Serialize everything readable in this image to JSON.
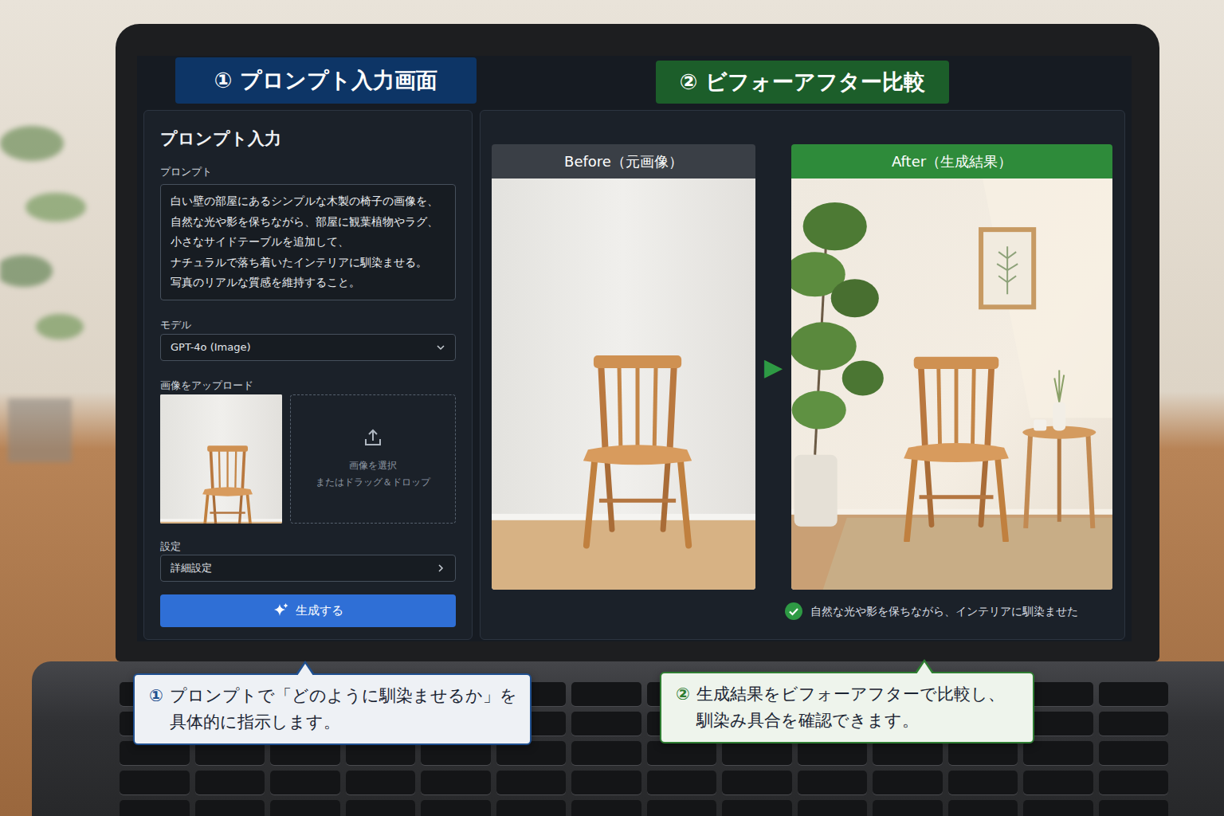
{
  "header_tabs": [
    {
      "number": "①",
      "label": "プロンプト入力画面",
      "color": "#0d3566"
    },
    {
      "number": "②",
      "label": "ビフォーアフター比較",
      "color": "#1c5e2a"
    }
  ],
  "prompt_panel": {
    "title": "プロンプト入力",
    "prompt_label": "プロンプト",
    "prompt_lines": [
      "白い壁の部屋にあるシンプルな木製の椅子の画像を、",
      "自然な光や影を保ちながら、部屋に観葉植物やラグ、",
      "小さなサイドテーブルを追加して、",
      "ナチュラルで落ち着いたインテリアに馴染ませる。",
      "写真のリアルな質感を維持すること。"
    ],
    "model_label": "モデル",
    "model_value": "GPT-4o (Image)",
    "upload_label": "画像をアップロード",
    "upload_hint": [
      "画像を選択",
      "またはドラッグ＆ドロップ"
    ],
    "settings_label": "設定",
    "settings_value": "詳細設定",
    "generate_button": "生成する"
  },
  "comparison": {
    "before_label": "Before（元画像）",
    "arrow": "▶",
    "after_label": "After（生成結果）",
    "result_note": "自然な光や影を保ちながら、インテリアに馴染ませた"
  },
  "callouts": [
    {
      "number": "①",
      "lines": [
        "プロンプトで「どのように馴染ませるか」を",
        "具体的に指示します。"
      ],
      "color": "#1f4f8f"
    },
    {
      "number": "②",
      "lines": [
        "生成結果をビフォーアフターで比較し、",
        "馴染み具合を確認できます。"
      ],
      "color": "#2e7d32"
    }
  ]
}
